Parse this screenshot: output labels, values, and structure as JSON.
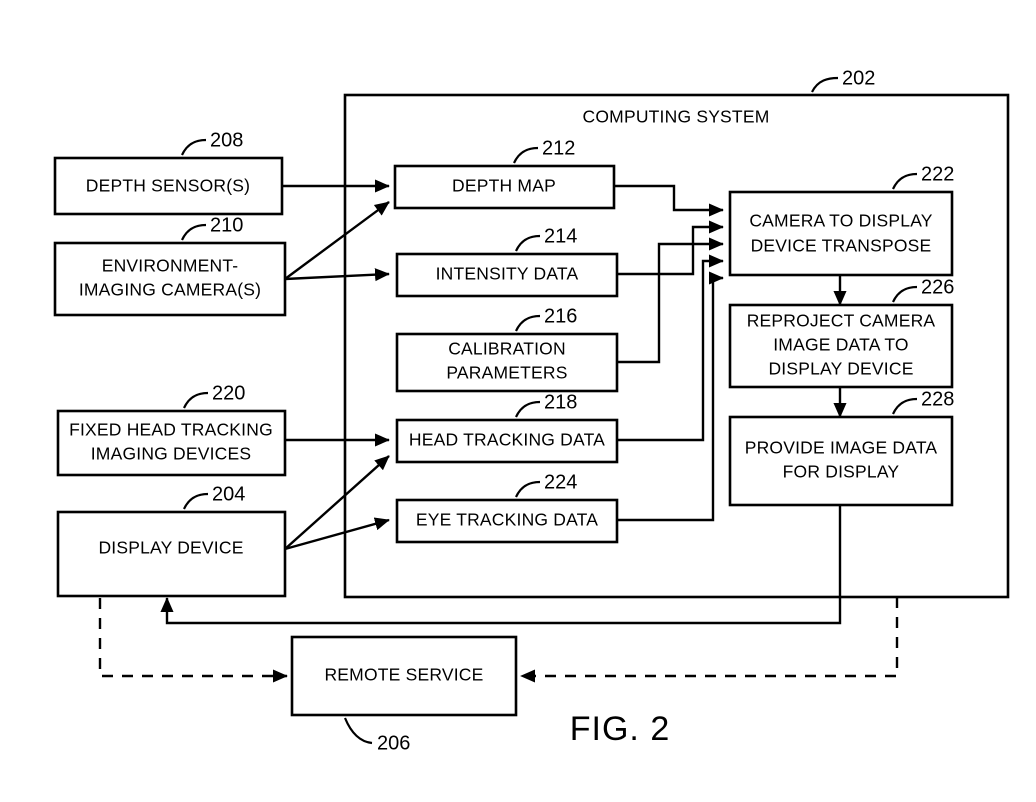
{
  "figure": {
    "caption": "FIG. 2",
    "system_title": "COMPUTING SYSTEM",
    "system_ref": "202"
  },
  "boxes": {
    "depth_sensors": {
      "label": "DEPTH SENSOR(S)",
      "ref": "208"
    },
    "environment_camera": {
      "line1": "ENVIRONMENT-",
      "line2": "IMAGING CAMERA(S)",
      "ref": "210"
    },
    "fixed_head_tracking": {
      "line1": "FIXED HEAD TRACKING",
      "line2": "IMAGING DEVICES",
      "ref": "220"
    },
    "display_device": {
      "label": "DISPLAY DEVICE",
      "ref": "204"
    },
    "depth_map": {
      "label": "DEPTH MAP",
      "ref": "212"
    },
    "intensity_data": {
      "label": "INTENSITY DATA",
      "ref": "214"
    },
    "calibration_parameters": {
      "line1": "CALIBRATION",
      "line2": "PARAMETERS",
      "ref": "216"
    },
    "head_tracking_data": {
      "label": "HEAD TRACKING DATA",
      "ref": "218"
    },
    "eye_tracking_data": {
      "label": "EYE TRACKING DATA",
      "ref": "224"
    },
    "camera_to_display_transpose": {
      "line1": "CAMERA TO DISPLAY",
      "line2": "DEVICE TRANSPOSE",
      "ref": "222"
    },
    "reproject_camera_image": {
      "line1": "REPROJECT CAMERA",
      "line2": "IMAGE DATA TO",
      "line3": "DISPLAY DEVICE",
      "ref": "226"
    },
    "provide_image_data": {
      "line1": "PROVIDE IMAGE DATA",
      "line2": "FOR DISPLAY",
      "ref": "228"
    },
    "remote_service": {
      "label": "REMOTE SERVICE",
      "ref": "206"
    }
  },
  "colors": {
    "stroke": "#000000",
    "background": "#ffffff"
  }
}
